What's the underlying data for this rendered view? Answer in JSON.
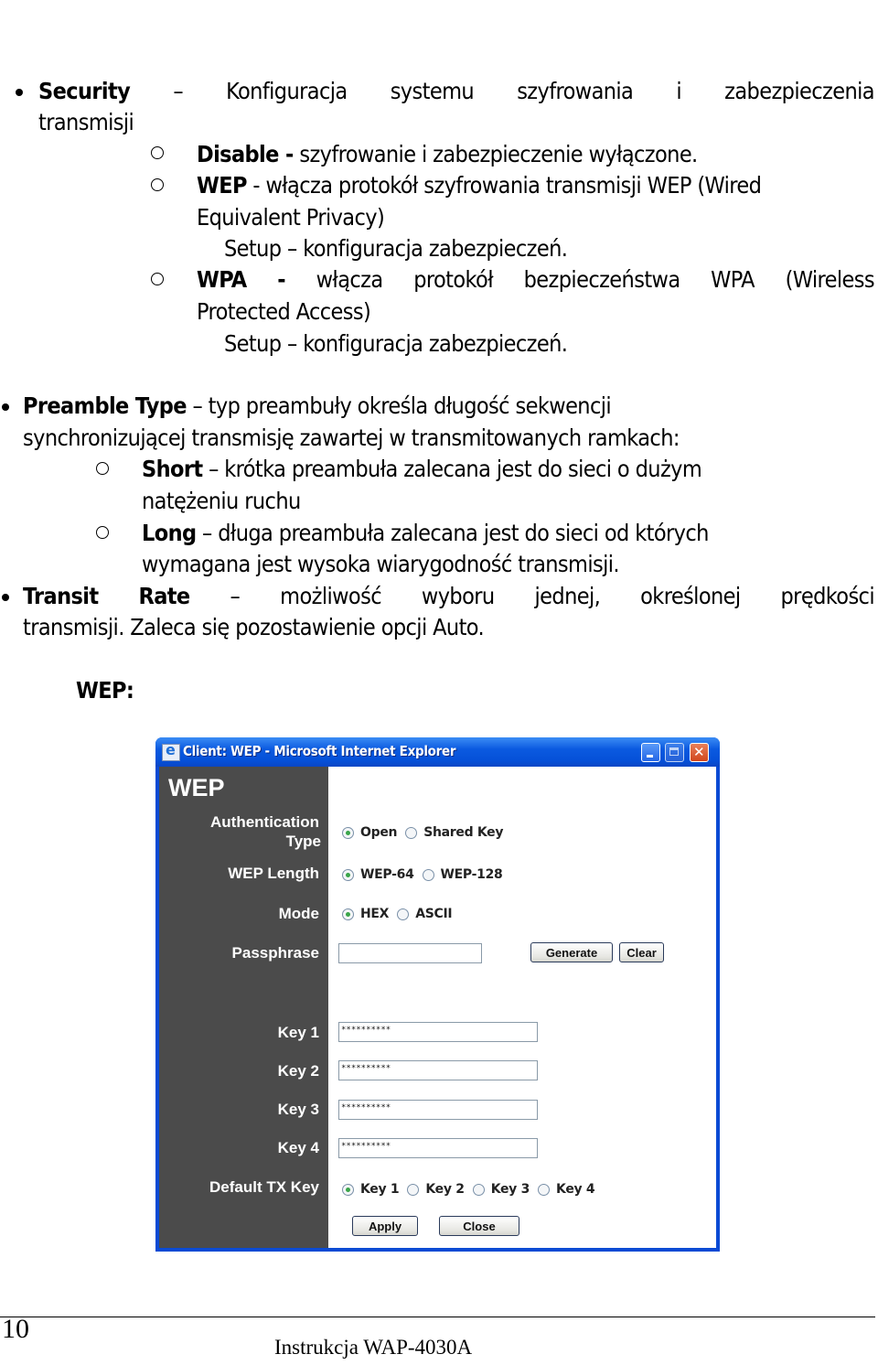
{
  "security": {
    "term": "Security",
    "dash": "–",
    "words": [
      "Konfiguracja",
      "systemu",
      "szyfrowania",
      "i",
      "zabezpieczenia"
    ],
    "line2": "transmisji",
    "items": [
      {
        "term": "Disable -",
        "text": " szyfrowanie i zabezpieczenie wyłączone."
      },
      {
        "term": "WEP",
        "text": " - włącza protokół szyfrowania transmisji WEP (Wired",
        "line2": "Equivalent Privacy)",
        "setup": "Setup – konfiguracja zabezpieczeń."
      },
      {
        "term": "WPA",
        "words": [
          "-",
          "włącza",
          "protokół",
          "bezpieczeństwa",
          "WPA",
          "(Wireless"
        ],
        "line2": "Protected Access)",
        "setup": "Setup – konfiguracja zabezpieczeń."
      }
    ]
  },
  "preamble": {
    "term": "Preamble Type",
    "text": " – typ preambuły określa długość sekwencji",
    "line2": "synchronizującej transmisję zawartej w transmitowanych ramkach:",
    "items": [
      {
        "term": "Short",
        "text": " – krótka preambuła zalecana jest do sieci o dużym",
        "line2": "natężeniu ruchu"
      },
      {
        "term": "Long",
        "text": " – długa preambuła zalecana jest do sieci od których",
        "line2": "wymagana jest wysoka wiarygodność transmisji."
      }
    ]
  },
  "transit": {
    "term1": "Transit",
    "term2": "Rate",
    "words": [
      "–",
      "możliwość",
      "wyboru",
      "jednej,",
      "określonej",
      "prędkości"
    ],
    "line2": "transmisji. Zaleca się pozostawienie opcji Auto."
  },
  "wep_heading": "WEP:",
  "window": {
    "title": "Client: WEP - Microsoft Internet Explorer",
    "panel_heading": "WEP",
    "auth_label_1": "Authentication",
    "auth_label_2": "Type",
    "auth_options": [
      {
        "label": "Open",
        "selected": true
      },
      {
        "label": "Shared Key",
        "selected": false
      }
    ],
    "length_label": "WEP Length",
    "length_options": [
      {
        "label": "WEP-64",
        "selected": true
      },
      {
        "label": "WEP-128",
        "selected": false
      }
    ],
    "mode_label": "Mode",
    "mode_options": [
      {
        "label": "HEX",
        "selected": true
      },
      {
        "label": "ASCII",
        "selected": false
      }
    ],
    "passphrase_label": "Passphrase",
    "passphrase_value": "",
    "generate_label": "Generate",
    "clear_label": "Clear",
    "keys": [
      {
        "label": "Key 1",
        "value": "**********"
      },
      {
        "label": "Key 2",
        "value": "**********"
      },
      {
        "label": "Key 3",
        "value": "**********"
      },
      {
        "label": "Key 4",
        "value": "**********"
      }
    ],
    "default_key_label": "Default TX Key",
    "default_key_options": [
      {
        "label": "Key 1",
        "selected": true
      },
      {
        "label": "Key 2",
        "selected": false
      },
      {
        "label": "Key 3",
        "selected": false
      },
      {
        "label": "Key 4",
        "selected": false
      }
    ],
    "apply_label": "Apply",
    "close_label": "Close"
  },
  "footer": {
    "page_number": "10",
    "title": "Instrukcja WAP-4030A"
  }
}
